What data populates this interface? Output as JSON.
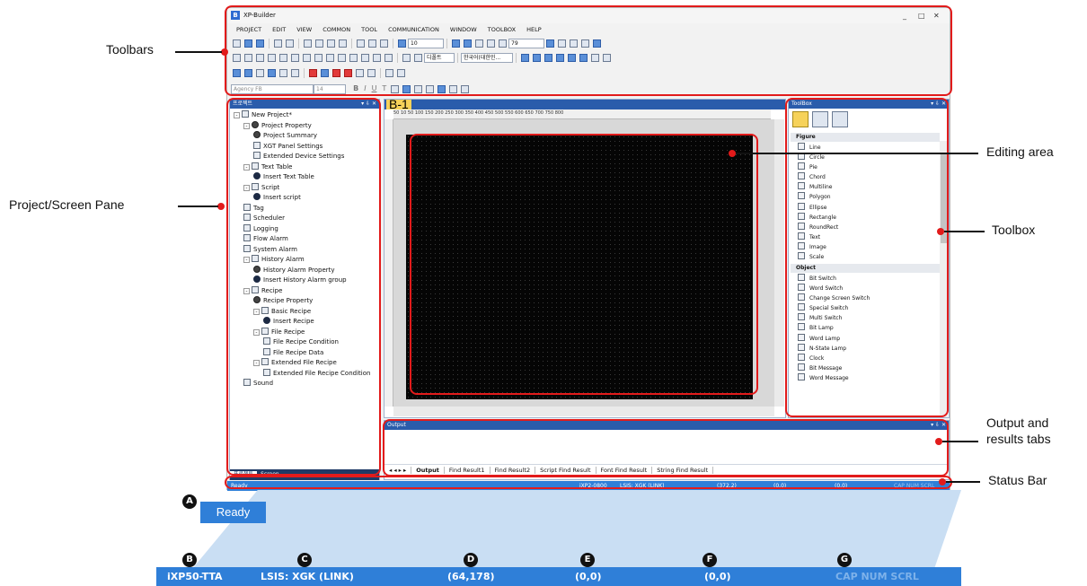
{
  "app": {
    "title": "XP-Builder",
    "logo": "B"
  },
  "window_controls": {
    "minimize": "_",
    "maximize": "□",
    "close": "✕"
  },
  "menu": [
    "PROJECT",
    "EDIT",
    "VIEW",
    "COMMON",
    "TOOL",
    "COMMUNICATION",
    "WINDOW",
    "TOOLBOX",
    "HELP"
  ],
  "toolbar": {
    "grid_size": "10",
    "zoom": "79",
    "font_combo1": "디폴트",
    "font_combo2": "한국어(대한민...",
    "font_name": "Agency FB",
    "font_size": "14"
  },
  "format_buttons": [
    "B",
    "I",
    "U",
    "T"
  ],
  "project_pane": {
    "title": "프로젝트",
    "header_buttons": "▾ ⇩ ✕",
    "tree": [
      {
        "label": "New Project*",
        "level": 0
      },
      {
        "label": "Project Property",
        "level": 1
      },
      {
        "label": "Project Summary",
        "level": 2
      },
      {
        "label": "XGT Panel Settings",
        "level": 2
      },
      {
        "label": "Extended Device Settings",
        "level": 2
      },
      {
        "label": "Text Table",
        "level": 1
      },
      {
        "label": "Insert Text Table",
        "level": 2
      },
      {
        "label": "Script",
        "level": 1
      },
      {
        "label": "Insert script",
        "level": 2
      },
      {
        "label": "Tag",
        "level": 1
      },
      {
        "label": "Scheduler",
        "level": 1
      },
      {
        "label": "Logging",
        "level": 1
      },
      {
        "label": "Flow Alarm",
        "level": 1
      },
      {
        "label": "System Alarm",
        "level": 1
      },
      {
        "label": "History Alarm",
        "level": 1
      },
      {
        "label": "History Alarm Property",
        "level": 2
      },
      {
        "label": "Insert History Alarm group",
        "level": 2
      },
      {
        "label": "Recipe",
        "level": 1
      },
      {
        "label": "Recipe Property",
        "level": 2
      },
      {
        "label": "Basic Recipe",
        "level": 2
      },
      {
        "label": "Insert Recipe",
        "level": 3
      },
      {
        "label": "File Recipe",
        "level": 2
      },
      {
        "label": "File Recipe Condition",
        "level": 3
      },
      {
        "label": "File Recipe Data",
        "level": 3
      },
      {
        "label": "Extended File Recipe",
        "level": 2
      },
      {
        "label": "Extended File Recipe Condition",
        "level": 3
      },
      {
        "label": "Sound",
        "level": 1
      }
    ],
    "tabs": [
      "프로젝트",
      "Screen"
    ]
  },
  "editor": {
    "tab": "B-1",
    "ruler": "50    10    50    100    150    200    250    300    350    400    450    500    550    600    650    700    750    800"
  },
  "toolbox": {
    "title": "ToolBox",
    "sections": [
      {
        "name": "Figure",
        "items": [
          "Line",
          "Circle",
          "Pie",
          "Chord",
          "Multiline",
          "Polygon",
          "Ellipse",
          "Rectangle",
          "RoundRect",
          "Text",
          "Image",
          "Scale"
        ]
      },
      {
        "name": "Object",
        "items": [
          "Bit Switch",
          "Word Switch",
          "Change Screen Switch",
          "Special Switch",
          "Multi Switch",
          "Bit Lamp",
          "Word Lamp",
          "N-State Lamp",
          "Clock",
          "Bit Message",
          "Word Message"
        ]
      }
    ]
  },
  "output": {
    "title": "Output",
    "nav": "◂ ◂ ▸ ▸",
    "tabs": [
      "Output",
      "Find Result1",
      "Find Result2",
      "Script Find Result",
      "Font Find Result",
      "String Find Result"
    ]
  },
  "status_bar": {
    "ready": "Ready",
    "model": "iXP2-0800",
    "plc": "LSIS: XGK (LINK)",
    "coord": "(372,2)",
    "v1": "(0,0)",
    "v2": "(0,0)",
    "keys": "CAP  NUM  SCRL"
  },
  "annotations": {
    "toolbars": "Toolbars",
    "project_pane": "Project/Screen Pane",
    "editing_area": "Editing area",
    "toolbox": "Toolbox",
    "output_line1": "Output and",
    "output_line2": "results tabs",
    "status_bar": "Status Bar"
  },
  "zoom_detail": {
    "ready": "Ready",
    "model": "iXP50-TTA",
    "plc": "LSIS: XGK (LINK)",
    "coord": "(64,178)",
    "v1": "(0,0)",
    "v2": "(0,0)",
    "keys": "CAP  NUM  SCRL",
    "badges": [
      "A",
      "B",
      "C",
      "D",
      "E",
      "F",
      "G"
    ]
  },
  "colors": {
    "callout": "#e21b1b",
    "status_blue": "#2f7fd8",
    "pane_header": "#2a5cab"
  }
}
